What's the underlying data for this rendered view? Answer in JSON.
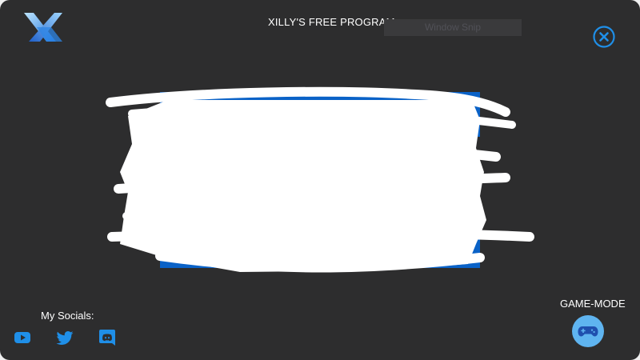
{
  "app": {
    "title": "XILLY'S FREE PROGRAM",
    "logo_icon": "x-logo-icon",
    "close_icon": "close-circle-icon"
  },
  "toolbar": {
    "snip_label": "Window Snip"
  },
  "menu": {
    "buttons": [
      {
        "label": ""
      },
      {
        "label": ""
      },
      {
        "label": ""
      }
    ],
    "note": ""
  },
  "socials": {
    "label": "My Socials:",
    "items": [
      {
        "icon": "youtube-icon"
      },
      {
        "icon": "twitter-icon"
      },
      {
        "icon": "discord-icon"
      }
    ]
  },
  "gamemode": {
    "label": "GAME-MODE",
    "icon": "gamepad-icon"
  },
  "colors": {
    "background": "#2d2d2e",
    "accent": "#1f8fe8",
    "menu_button": "#0a62c7",
    "gamemode_button": "#5fb4f0",
    "text": "#ffffff"
  }
}
